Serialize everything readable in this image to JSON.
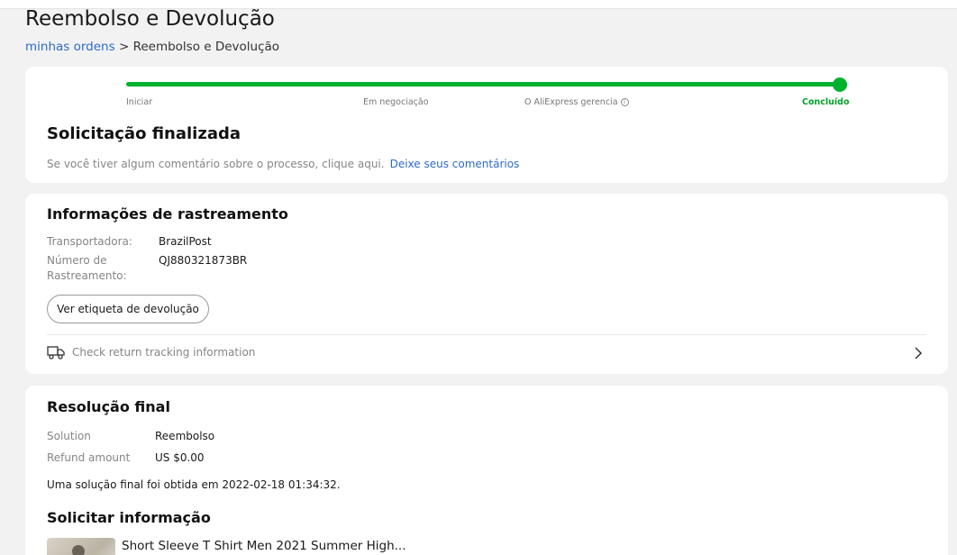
{
  "page": {
    "title": "Reembolso e Devolução",
    "breadcrumb": {
      "link": "minhas ordens",
      "separator": ">",
      "current": "Reembolso e Devolução"
    }
  },
  "progress": {
    "steps": [
      "Iniciar",
      "Em negociação",
      "O AliExpress gerencia",
      "Concluído"
    ],
    "completed_fraction": 1.0,
    "accent_color": "#00b12d",
    "info_icon": "info-icon"
  },
  "status": {
    "title": "Solicitação finalizada",
    "feedback_text": "Se você tiver algum comentário sobre o processo, clique aqui.",
    "feedback_link": "Deixe seus comentários"
  },
  "tracking": {
    "title": "Informações de rastreamento",
    "carrier_label": "Transportadora:",
    "carrier_value": "BrazilPost",
    "number_label_1": "Número de",
    "number_label_2": "Rastreamento:",
    "number_value": "QJ880321873BR",
    "label_button": "Ver etiqueta de devolução",
    "check_text": "Check return tracking information",
    "icons": [
      "truck-icon",
      "chevron-right-icon"
    ]
  },
  "resolution": {
    "title": "Resolução final",
    "solution_label": "Solution",
    "solution_value": "Reembolso",
    "refund_label": "Refund amount",
    "refund_value": "US $0.00",
    "final_note": "Uma solução final foi obtida em 2022-02-18 01:34:32.",
    "request_title": "Solicitar informação",
    "product_name": "Short Sleeve T Shirt Men 2021 Summer High..."
  }
}
